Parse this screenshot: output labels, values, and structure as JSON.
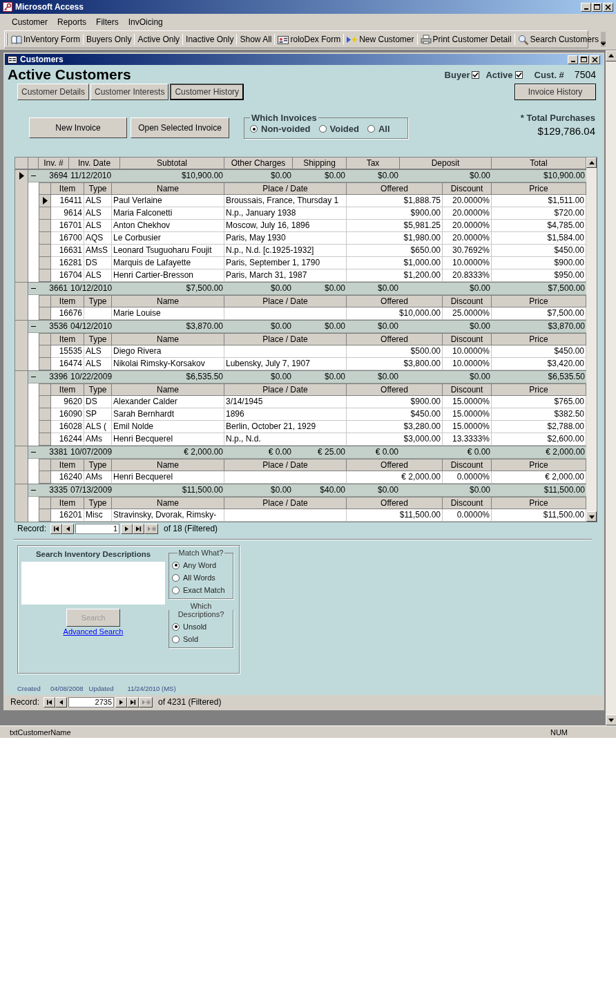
{
  "app": {
    "title": "Microsoft Access"
  },
  "menu": [
    {
      "label": "Customer"
    },
    {
      "label": "Reports"
    },
    {
      "label": "Filters"
    },
    {
      "label": "InvOicing"
    }
  ],
  "toolbar": [
    {
      "label": "InVentory Form",
      "kind": "book"
    },
    {
      "label": "Buyers Only"
    },
    {
      "label": "Active Only"
    },
    {
      "label": "Inactive Only"
    },
    {
      "label": "Show All"
    },
    {
      "label": "roloDex Form",
      "kind": "card"
    },
    {
      "label": "New Customer",
      "kind": "new"
    },
    {
      "label": "Print Customer Detail",
      "kind": "printer"
    },
    {
      "label": "Search Customers",
      "kind": "search"
    }
  ],
  "form": {
    "title": "Customers",
    "heading": "Active Customers",
    "buyer": {
      "label": "Buyer",
      "checked": true
    },
    "active": {
      "label": "Active",
      "checked": true
    },
    "cust_label": "Cust. #",
    "cust_number": "7504",
    "tabs": [
      {
        "label": "Customer Details",
        "selected": false
      },
      {
        "label": "Customer Interests",
        "selected": false
      },
      {
        "label": "Customer History",
        "selected": true
      }
    ],
    "invoice_history": "Invoice History",
    "buttons": [
      "New Invoice",
      "Open Selected Invoice"
    ],
    "which_invoices": {
      "title": "Which Invoices",
      "options": [
        {
          "label": "Non-voided",
          "selected": true
        },
        {
          "label": "Voided",
          "selected": false
        },
        {
          "label": "All",
          "selected": false
        }
      ]
    },
    "total_label": "* Total Purchases",
    "total": "$129,786.04",
    "datasheet": {
      "columns": [
        "Inv. #",
        "Inv. Date",
        "Subtotal",
        "Other Charges",
        "Shipping",
        "Tax",
        "Deposit",
        "Total"
      ],
      "invoices": [
        {
          "selected": true,
          "expanded": true,
          "number": "3694",
          "date": "11/12/2010",
          "subtotal": "$10,900.00",
          "other_charges": "$0.00",
          "shipping": "$0.00",
          "tax": "$0.00",
          "deposit": "$0.00",
          "total": "$10,900.00",
          "item_columns": [
            "Item",
            "Type",
            "Name",
            "Place / Date",
            "Offered",
            "Discount",
            "Price"
          ],
          "items": [
            {
              "selected": true,
              "item": "16411",
              "type": "ALS",
              "name": "Paul Verlaine",
              "place": "Broussais, France, Thursday 1",
              "offered": "$1,888.75",
              "discount": "20.0000%",
              "price": "$1,511.00"
            },
            {
              "selected": false,
              "item": "9614",
              "type": "ALS",
              "name": "Maria Falconetti",
              "place": "N.p., January 1938",
              "offered": "$900.00",
              "discount": "20.0000%",
              "price": "$720.00"
            },
            {
              "selected": false,
              "item": "16701",
              "type": "ALS",
              "name": "Anton Chekhov",
              "place": "Moscow, July 16, 1896",
              "offered": "$5,981.25",
              "discount": "20.0000%",
              "price": "$4,785.00"
            },
            {
              "selected": false,
              "item": "16700",
              "type": "AQS",
              "name": "Le Corbusier",
              "place": "Paris, May 1930",
              "offered": "$1,980.00",
              "discount": "20.0000%",
              "price": "$1,584.00"
            },
            {
              "selected": false,
              "item": "16631",
              "type": "AMsS",
              "name": "Leonard Tsuguoharu Foujit",
              "place": "N.p., N.d. [c.1925-1932]",
              "offered": "$650.00",
              "discount": "30.7692%",
              "price": "$450.00"
            },
            {
              "selected": false,
              "item": "16281",
              "type": "DS",
              "name": "Marquis de Lafayette",
              "place": "Paris, September 1, 1790",
              "offered": "$1,000.00",
              "discount": "10.0000%",
              "price": "$900.00"
            },
            {
              "selected": false,
              "item": "16704",
              "type": "ALS",
              "name": "Henri Cartier-Bresson",
              "place": "Paris, March 31, 1987",
              "offered": "$1,200.00",
              "discount": "20.8333%",
              "price": "$950.00"
            }
          ]
        },
        {
          "selected": false,
          "expanded": true,
          "number": "3661",
          "date": "10/12/2010",
          "subtotal": "$7,500.00",
          "other_charges": "$0.00",
          "shipping": "$0.00",
          "tax": "$0.00",
          "deposit": "$0.00",
          "total": "$7,500.00",
          "item_columns": [
            "Item",
            "Type",
            "Name",
            "Place / Date",
            "Offered",
            "Discount",
            "Price"
          ],
          "items": [
            {
              "selected": false,
              "item": "16676",
              "name": "Marie Louise",
              "offered": "$10,000.00",
              "discount": "25.0000%",
              "price": "$7,500.00"
            }
          ]
        },
        {
          "selected": false,
          "expanded": true,
          "number": "3536",
          "date": "04/12/2010",
          "subtotal": "$3,870.00",
          "other_charges": "$0.00",
          "shipping": "$0.00",
          "tax": "$0.00",
          "deposit": "$0.00",
          "total": "$3,870.00",
          "item_columns": [
            "Item",
            "Type",
            "Name",
            "Place / Date",
            "Offered",
            "Discount",
            "Price"
          ],
          "items": [
            {
              "selected": false,
              "item": "15535",
              "type": "ALS",
              "name": "Diego Rivera",
              "offered": "$500.00",
              "discount": "10.0000%",
              "price": "$450.00"
            },
            {
              "selected": false,
              "item": "16474",
              "type": "ALS",
              "name": "Nikolai Rimsky-Korsakov",
              "place": "Lubensky, July 7, 1907",
              "offered": "$3,800.00",
              "discount": "10.0000%",
              "price": "$3,420.00"
            }
          ]
        },
        {
          "selected": false,
          "expanded": true,
          "number": "3396",
          "date": "10/22/2009",
          "subtotal": "$6,535.50",
          "other_charges": "$0.00",
          "shipping": "$0.00",
          "tax": "$0.00",
          "deposit": "$0.00",
          "total": "$6,535.50",
          "item_columns": [
            "Item",
            "Type",
            "Name",
            "Place / Date",
            "Offered",
            "Discount",
            "Price"
          ],
          "items": [
            {
              "selected": false,
              "item": "9620",
              "type": "DS",
              "name": "Alexander Calder",
              "place": "3/14/1945",
              "offered": "$900.00",
              "discount": "15.0000%",
              "price": "$765.00"
            },
            {
              "selected": false,
              "item": "16090",
              "type": "SP",
              "name": "Sarah Bernhardt",
              "place": "1896",
              "offered": "$450.00",
              "discount": "15.0000%",
              "price": "$382.50"
            },
            {
              "selected": false,
              "item": "16028",
              "type": "ALS (",
              "name": "Emil Nolde",
              "place": "Berlin, October 21, 1929",
              "offered": "$3,280.00",
              "discount": "15.0000%",
              "price": "$2,788.00"
            },
            {
              "selected": false,
              "item": "16244",
              "type": "AMs",
              "name": "Henri Becquerel",
              "place": "N.p., N.d.",
              "offered": "$3,000.00",
              "discount": "13.3333%",
              "price": "$2,600.00"
            }
          ]
        },
        {
          "selected": false,
          "expanded": true,
          "number": "3381",
          "date": "10/07/2009",
          "subtotal": "€ 2,000.00",
          "other_charges": "€ 0.00",
          "shipping": "€ 25.00",
          "tax": "€ 0.00",
          "deposit": "€ 0.00",
          "total": "€ 2,000.00",
          "item_columns": [
            "Item",
            "Type",
            "Name",
            "Place / Date",
            "Offered",
            "Discount",
            "Price"
          ],
          "items": [
            {
              "selected": false,
              "item": "16240",
              "type": "AMs",
              "name": "Henri Becquerel",
              "offered": "€ 2,000.00",
              "discount": "0.0000%",
              "price": "€ 2,000.00"
            }
          ]
        },
        {
          "selected": false,
          "expanded": true,
          "number": "3335",
          "date": "07/13/2009",
          "subtotal": "$11,500.00",
          "other_charges": "$0.00",
          "shipping": "$40.00",
          "tax": "$0.00",
          "deposit": "$0.00",
          "total": "$11,500.00",
          "item_columns": [
            "Item",
            "Type",
            "Name",
            "Place / Date",
            "Offered",
            "Discount",
            "Price"
          ],
          "items": [
            {
              "selected": false,
              "item": "16201",
              "type": "Misc",
              "name": "Stravinsky, Dvorak, Rimsky-",
              "offered": "$11,500.00",
              "discount": "0.0000%",
              "price": "$11,500.00"
            }
          ]
        }
      ],
      "nav": {
        "label": "Record:",
        "current": "1",
        "total": "of  18 (Filtered)"
      }
    },
    "search": {
      "title": "Search Inventory Descriptions",
      "button": {
        "label": "Search",
        "disabled": true
      },
      "link": "Advanced Search",
      "match": {
        "title": "Match What?",
        "options": [
          {
            "label": "Any Word",
            "selected": true
          },
          {
            "label": "All Words",
            "selected": false
          },
          {
            "label": "Exact Match",
            "selected": false
          }
        ]
      },
      "descriptions": {
        "title": "Which Descriptions?",
        "options": [
          {
            "label": "Unsold",
            "selected": true
          },
          {
            "label": "Sold",
            "selected": false
          }
        ]
      }
    },
    "footer": {
      "created_label": "Created",
      "created": "04/08/2008",
      "updated_label": "Updated",
      "updated": "11/24/2010 (MS)"
    },
    "nav": {
      "label": "Record:",
      "current": "2735",
      "total": "of  4231 (Filtered)"
    }
  },
  "status_bar": {
    "text": "txtCustomerName",
    "num": "NUM"
  }
}
